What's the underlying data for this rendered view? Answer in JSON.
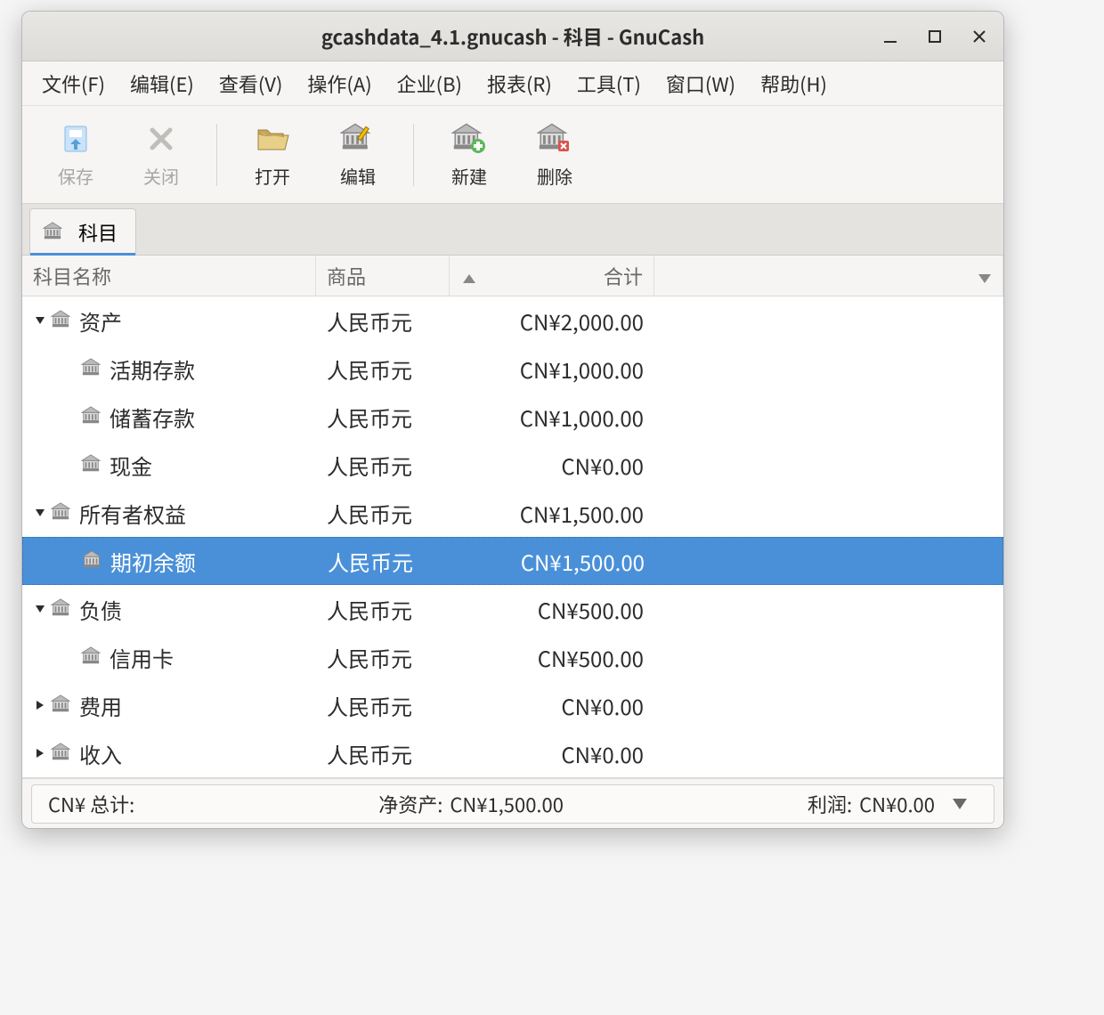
{
  "window": {
    "title": "gcashdata_4.1.gnucash - 科目 - GnuCash"
  },
  "menubar": [
    "文件(F)",
    "编辑(E)",
    "查看(V)",
    "操作(A)",
    "企业(B)",
    "报表(R)",
    "工具(T)",
    "窗口(W)",
    "帮助(H)"
  ],
  "toolbar": {
    "save": "保存",
    "close": "关闭",
    "open": "打开",
    "edit": "编辑",
    "new": "新建",
    "delete": "删除"
  },
  "tab": {
    "label": "科目"
  },
  "columns": {
    "name": "科目名称",
    "commodity": "商品",
    "total": "合计"
  },
  "rows": [
    {
      "name": "资产",
      "commodity": "人民币元",
      "total": "CN¥2,000.00",
      "level": 0,
      "expanded": true,
      "has_children": true,
      "selected": false
    },
    {
      "name": "活期存款",
      "commodity": "人民币元",
      "total": "CN¥1,000.00",
      "level": 1,
      "expanded": false,
      "has_children": false,
      "selected": false
    },
    {
      "name": "储蓄存款",
      "commodity": "人民币元",
      "total": "CN¥1,000.00",
      "level": 1,
      "expanded": false,
      "has_children": false,
      "selected": false
    },
    {
      "name": "现金",
      "commodity": "人民币元",
      "total": "CN¥0.00",
      "level": 1,
      "expanded": false,
      "has_children": false,
      "selected": false
    },
    {
      "name": "所有者权益",
      "commodity": "人民币元",
      "total": "CN¥1,500.00",
      "level": 0,
      "expanded": true,
      "has_children": true,
      "selected": false
    },
    {
      "name": "期初余额",
      "commodity": "人民币元",
      "total": "CN¥1,500.00",
      "level": 1,
      "expanded": false,
      "has_children": false,
      "selected": true
    },
    {
      "name": "负债",
      "commodity": "人民币元",
      "total": "CN¥500.00",
      "level": 0,
      "expanded": true,
      "has_children": true,
      "selected": false
    },
    {
      "name": "信用卡",
      "commodity": "人民币元",
      "total": "CN¥500.00",
      "level": 1,
      "expanded": false,
      "has_children": false,
      "selected": false
    },
    {
      "name": "费用",
      "commodity": "人民币元",
      "total": "CN¥0.00",
      "level": 0,
      "expanded": false,
      "has_children": true,
      "selected": false
    },
    {
      "name": "收入",
      "commodity": "人民币元",
      "total": "CN¥0.00",
      "level": 0,
      "expanded": false,
      "has_children": true,
      "selected": false
    }
  ],
  "statusbar": {
    "currency_total_label": "CN¥ 总计:",
    "net_assets_label": "净资产:",
    "net_assets_value": "CN¥1,500.00",
    "profit_label": "利润:",
    "profit_value": "CN¥0.00"
  }
}
